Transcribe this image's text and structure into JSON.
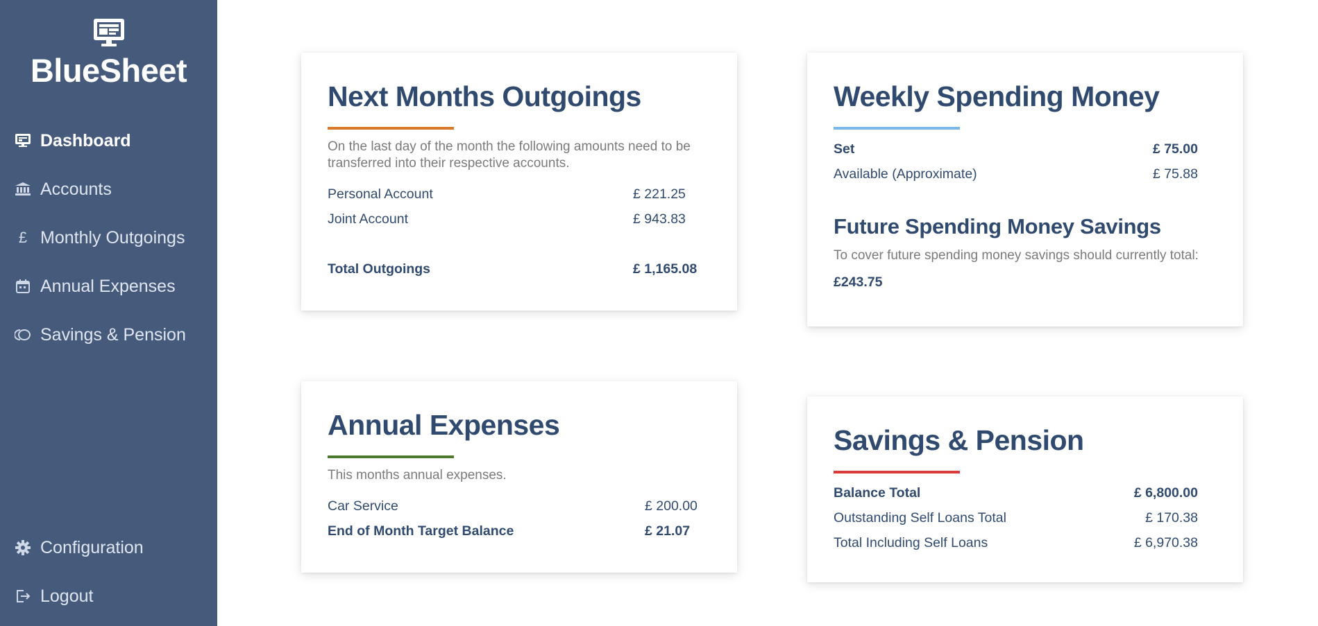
{
  "app": {
    "name": "BlueSheet"
  },
  "sidebar": {
    "items": [
      {
        "label": "Dashboard",
        "icon": "monitor-icon",
        "active": true
      },
      {
        "label": "Accounts",
        "icon": "bank-icon"
      },
      {
        "label": "Monthly Outgoings",
        "icon": "pound-icon"
      },
      {
        "label": "Annual Expenses",
        "icon": "calendar-icon"
      },
      {
        "label": "Savings & Pension",
        "icon": "savings-icon"
      }
    ],
    "bottom_items": [
      {
        "label": "Configuration",
        "icon": "gear-icon"
      },
      {
        "label": "Logout",
        "icon": "logout-icon"
      }
    ]
  },
  "outgoings": {
    "title": "Next Months Outgoings",
    "accent": "#d97a2b",
    "description": "On the last day of the month the following amounts need to be transferred into their respective accounts.",
    "rows": [
      {
        "label": "Personal Account",
        "value": "£ 221.25"
      },
      {
        "label": "Joint Account",
        "value": "£ 943.83"
      }
    ],
    "total": {
      "label": "Total Outgoings",
      "value": "£ 1,165.08"
    }
  },
  "spending": {
    "title": "Weekly Spending Money",
    "accent": "#7ab8ea",
    "set": {
      "label": "Set",
      "value": "£ 75.00"
    },
    "available": {
      "label": "Available (Approximate)",
      "value": "£ 75.88"
    },
    "future_title": "Future Spending Money Savings",
    "future_description": "To cover future spending money savings should currently total:",
    "future_total": "£243.75"
  },
  "annual": {
    "title": "Annual Expenses",
    "accent": "#4b7a2f",
    "description": "This months annual expenses.",
    "rows": [
      {
        "label": "Car Service",
        "value": "£ 200.00"
      }
    ],
    "target": {
      "label": "End of Month Target Balance",
      "value": "£ 21.07"
    }
  },
  "savings": {
    "title": "Savings & Pension",
    "accent": "#d93a3a",
    "balance": {
      "label": "Balance Total",
      "value": "£ 6,800.00"
    },
    "loans": {
      "label": "Outstanding Self Loans Total",
      "value": "£ 170.38"
    },
    "including": {
      "label": "Total Including Self Loans",
      "value": "£ 6,970.38"
    }
  }
}
